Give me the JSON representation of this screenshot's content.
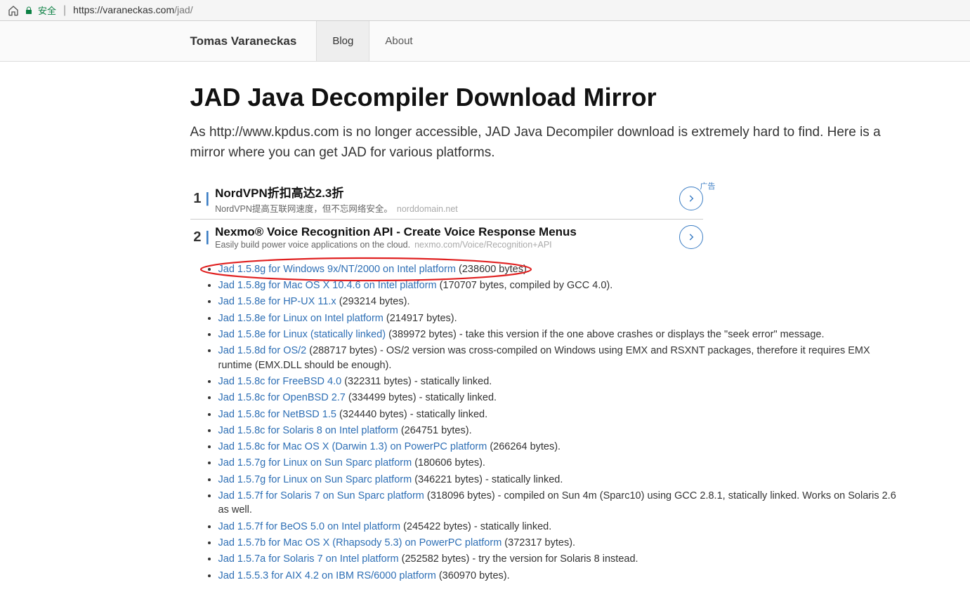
{
  "browser": {
    "secure": "安全",
    "url_host": "https://varaneckas.com",
    "url_path": "/jad/"
  },
  "nav": {
    "site_title": "Tomas Varaneckas",
    "tabs": [
      {
        "label": "Blog",
        "active": true
      },
      {
        "label": "About",
        "active": false
      }
    ]
  },
  "page": {
    "title": "JAD Java Decompiler Download Mirror",
    "intro": "As http://www.kpdus.com is no longer accessible, JAD Java Decompiler download is extremely hard to find. Here is a mirror where you can get JAD for various platforms."
  },
  "ads": {
    "label": "广告",
    "items": [
      {
        "num": "1",
        "title": "NordVPN折扣高达2.3折",
        "sub": "NordVPN提高互联网速度，但不忘网络安全。",
        "domain": "norddomain.net"
      },
      {
        "num": "2",
        "title": "Nexmo® Voice Recognition API - Create Voice Response Menus",
        "sub": "Easily build power voice applications on the cloud.",
        "domain": "nexmo.com/Voice/Recognition+API"
      }
    ]
  },
  "downloads": [
    {
      "link": "Jad 1.5.8g for Windows 9x/NT/2000 on Intel platform",
      "rest": " (238600 bytes)."
    },
    {
      "link": "Jad 1.5.8g for Mac OS X 10.4.6 on Intel platform",
      "rest": " (170707 bytes, compiled by GCC 4.0)."
    },
    {
      "link": "Jad 1.5.8e for HP-UX 11.x",
      "rest": " (293214 bytes)."
    },
    {
      "link": "Jad 1.5.8e for Linux on Intel platform",
      "rest": " (214917 bytes)."
    },
    {
      "link": "Jad 1.5.8e for Linux (statically linked)",
      "rest": " (389972 bytes) - take this version if the one above crashes or displays the \"seek error\" message."
    },
    {
      "link": "Jad 1.5.8d for OS/2",
      "rest": " (288717 bytes) - OS/2 version was cross-compiled on Windows using EMX and RSXNT packages, therefore it requires EMX runtime (EMX.DLL should be enough)."
    },
    {
      "link": "Jad 1.5.8c for FreeBSD 4.0",
      "rest": " (322311 bytes) - statically linked."
    },
    {
      "link": "Jad 1.5.8c for OpenBSD 2.7",
      "rest": " (334499 bytes) - statically linked."
    },
    {
      "link": "Jad 1.5.8c for NetBSD 1.5",
      "rest": " (324440 bytes) - statically linked."
    },
    {
      "link": "Jad 1.5.8c for Solaris 8 on Intel platform",
      "rest": " (264751 bytes)."
    },
    {
      "link": "Jad 1.5.8c for Mac OS X (Darwin 1.3) on PowerPC platform",
      "rest": " (266264 bytes)."
    },
    {
      "link": "Jad 1.5.7g for Linux on Sun Sparc platform",
      "rest": " (180606 bytes)."
    },
    {
      "link": "Jad 1.5.7g for Linux on Sun Sparc platform",
      "rest": " (346221 bytes) - statically linked."
    },
    {
      "link": "Jad 1.5.7f for Solaris 7 on Sun Sparc platform",
      "rest": " (318096 bytes) - compiled on Sun 4m (Sparc10) using GCC 2.8.1, statically linked. Works on Solaris 2.6 as well."
    },
    {
      "link": "Jad 1.5.7f for BeOS 5.0 on Intel platform",
      "rest": " (245422 bytes) - statically linked."
    },
    {
      "link": "Jad 1.5.7b for Mac OS X (Rhapsody 5.3) on PowerPC platform",
      "rest": " (372317 bytes)."
    },
    {
      "link": "Jad 1.5.7a for Solaris 7 on Intel platform",
      "rest": " (252582 bytes) - try the version for Solaris 8 instead."
    },
    {
      "link": "Jad 1.5.5.3 for AIX 4.2 on IBM RS/6000 platform",
      "rest": " (360970 bytes)."
    }
  ]
}
